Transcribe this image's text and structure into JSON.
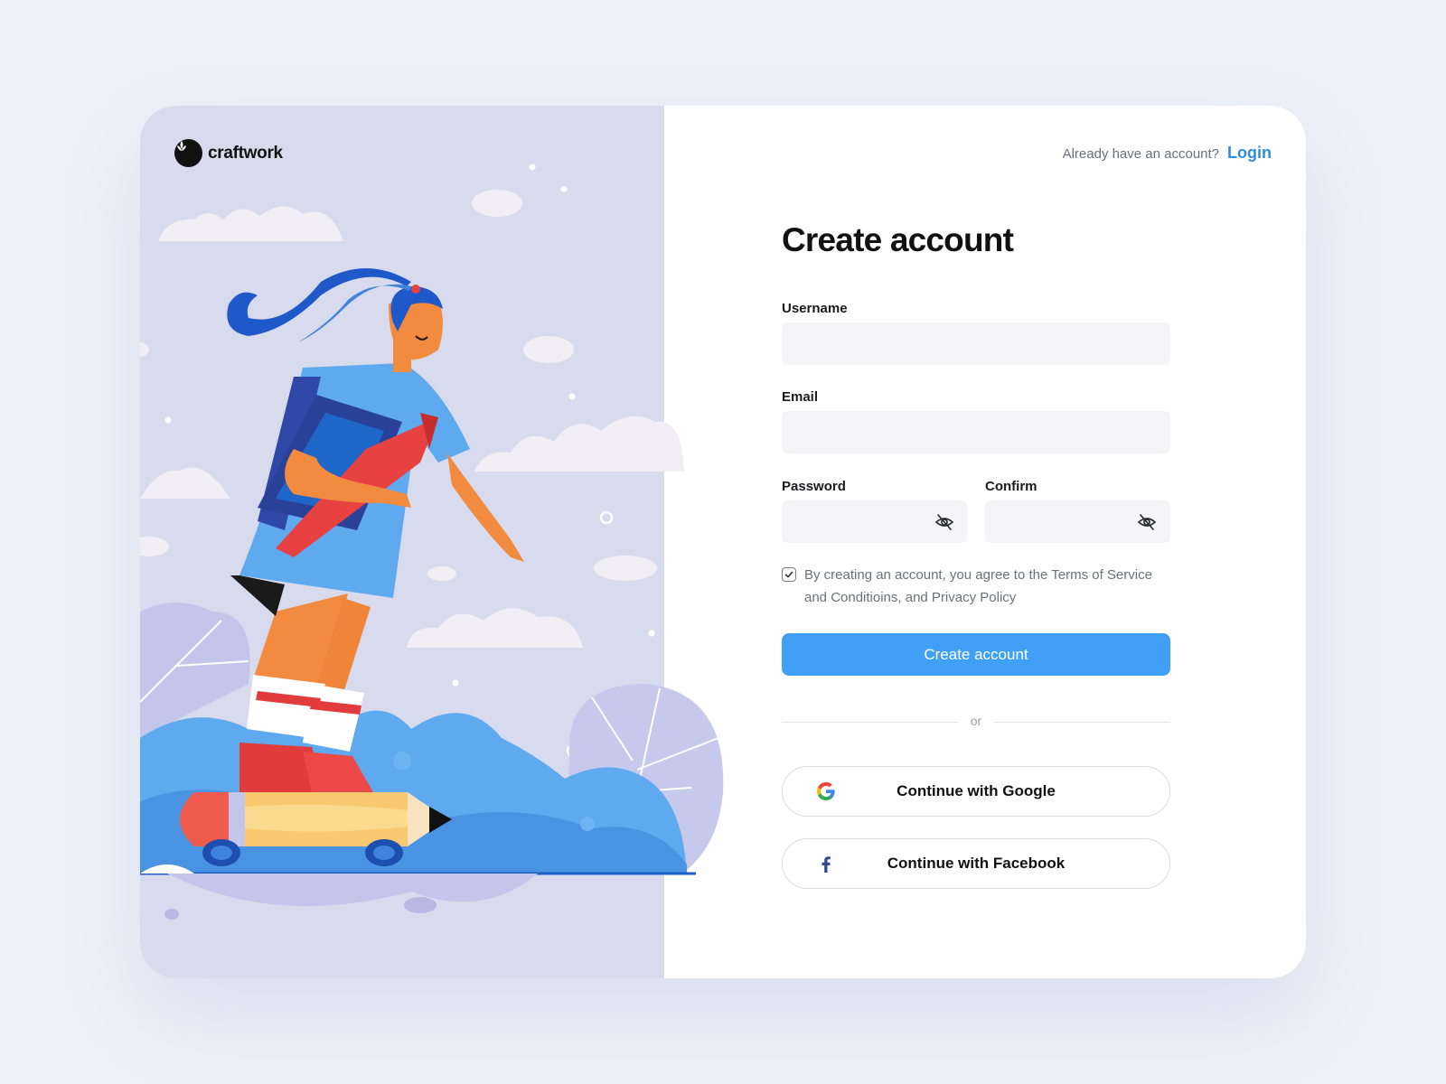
{
  "brand": {
    "name": "craftwork",
    "logo_icon": "leaf-icon"
  },
  "header": {
    "question": "Already have an account?",
    "login_link": "Login"
  },
  "form": {
    "title": "Create account",
    "username": {
      "label": "Username",
      "value": "",
      "placeholder": ""
    },
    "email": {
      "label": "Email",
      "value": "",
      "placeholder": ""
    },
    "password": {
      "label": "Password",
      "value": "",
      "placeholder": "",
      "toggle_icon": "eye-off-icon"
    },
    "confirm": {
      "label": "Confirm",
      "value": "",
      "placeholder": "",
      "toggle_icon": "eye-off-icon"
    },
    "terms": {
      "checked": true,
      "text": "By creating an account, you agree to the Terms of Service and Conditioins, and Privacy Policy"
    },
    "submit_label": "Create account",
    "divider_text": "or",
    "google_label": "Continue with Google",
    "facebook_label": "Continue with Facebook"
  },
  "colors": {
    "accent": "#3fa0f5",
    "link": "#2f8ae5",
    "illustration_bg": "#d8dbee",
    "page_bg": "#eef1f9"
  }
}
